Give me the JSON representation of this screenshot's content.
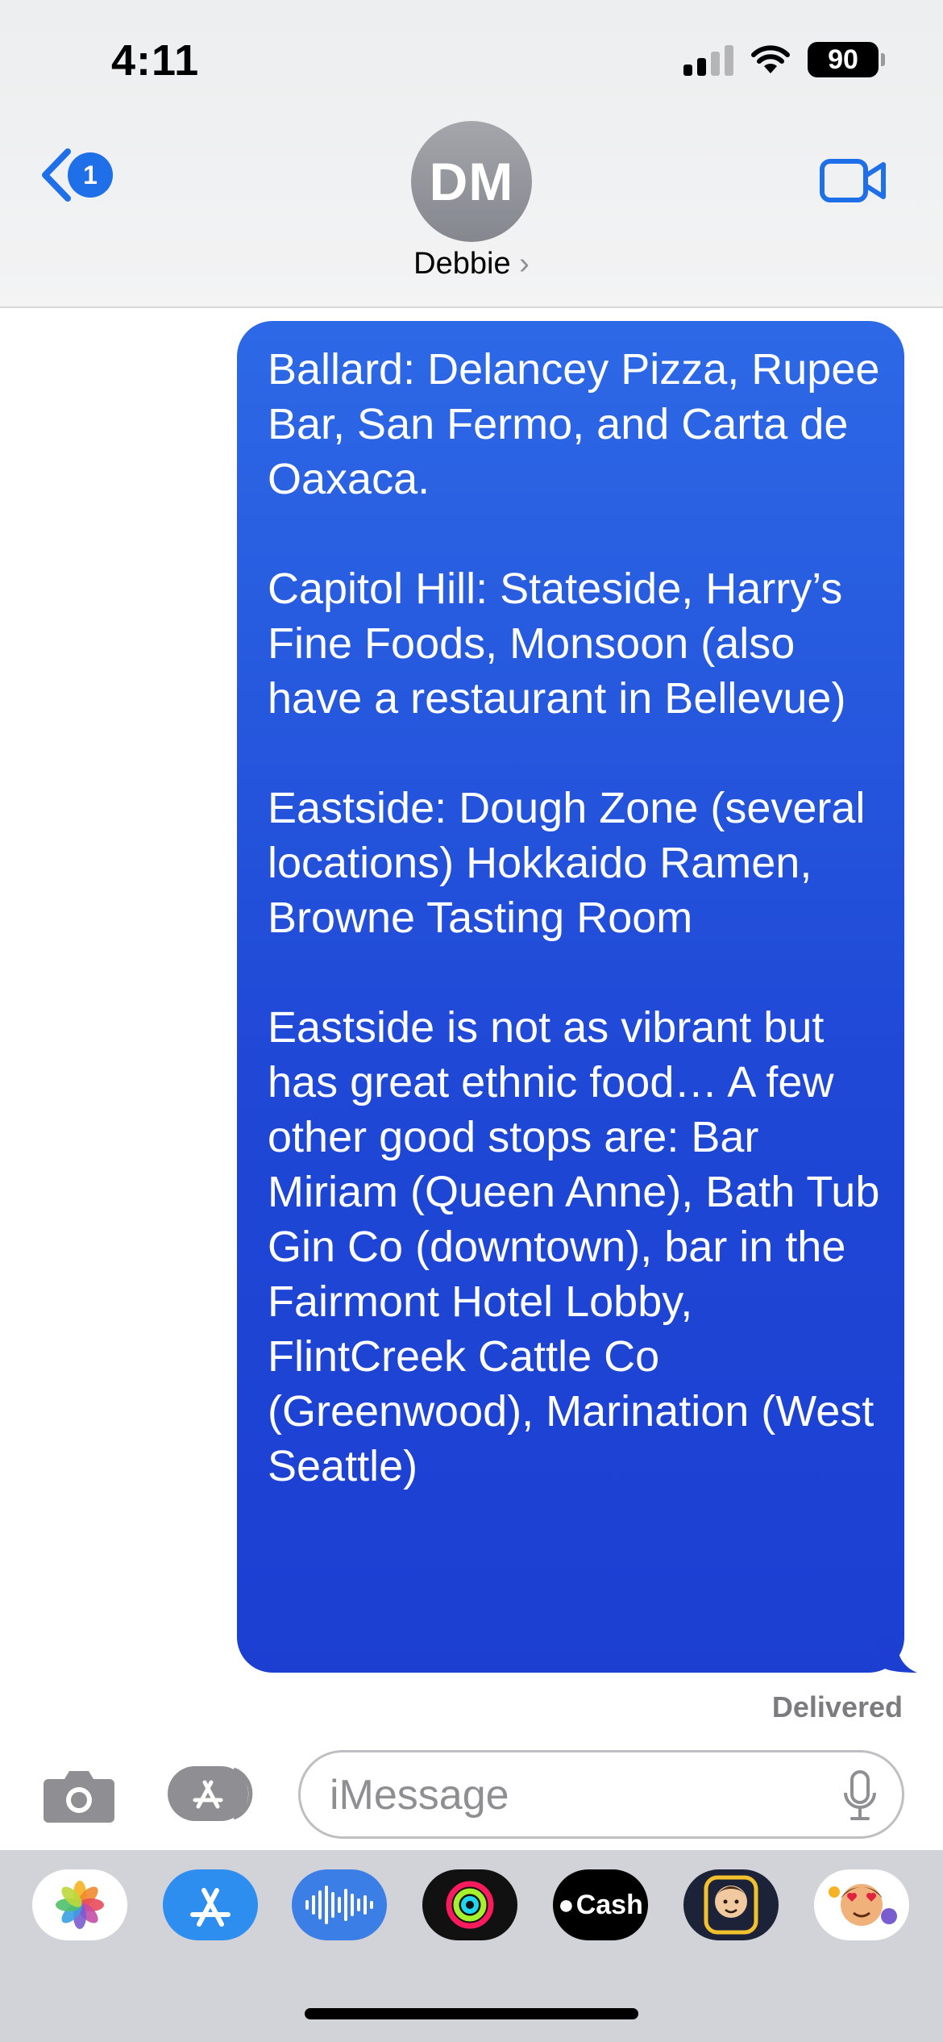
{
  "status_bar": {
    "time": "4:11",
    "battery": "90"
  },
  "header": {
    "back_badge": "1",
    "avatar_initials": "DM",
    "contact_name": "Debbie",
    "name_chevron": "›"
  },
  "message": {
    "paragraphs": [
      "Ballard: Delancey Pizza, Rupee Bar, San Fermo, and Carta de Oaxaca.",
      "Capitol Hill: Stateside, Harry’s Fine Foods, Monsoon (also have a restaurant in Bellevue)",
      "Eastside: Dough Zone (several locations) Hokkaido Ramen, Browne Tasting Room",
      "Eastside is not as vibrant but has great ethnic food… A few other good stops are: Bar Miriam (Queen Anne), Bath Tub Gin Co (downtown), bar in the Fairmont Hotel Lobby, FlintCreek Cattle Co (Greenwood), Marination (West Seattle)"
    ],
    "status": "Delivered"
  },
  "composer": {
    "placeholder": "iMessage",
    "value": ""
  },
  "app_drawer": {
    "apps": [
      {
        "name": "photos-icon"
      },
      {
        "name": "app-store-icon"
      },
      {
        "name": "audio-message-icon"
      },
      {
        "name": "fitness-icon"
      },
      {
        "name": "apple-cash-icon",
        "label": "Cash"
      },
      {
        "name": "memoji-icon"
      },
      {
        "name": "animoji-stickers-icon"
      }
    ]
  },
  "colors": {
    "accent": "#1e6fe8",
    "bubble_top": "#2d69e6",
    "bubble_bottom": "#1c3fd2",
    "drawer_bg": "#d2d3d8"
  }
}
